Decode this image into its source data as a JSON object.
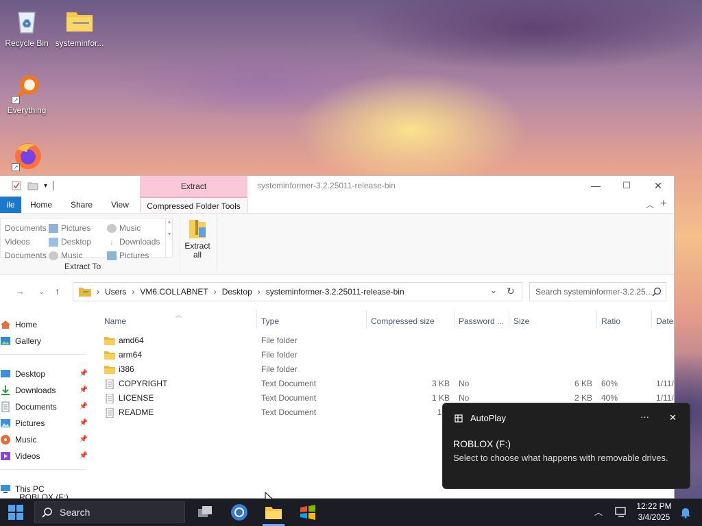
{
  "desktop": {
    "icons": [
      {
        "label": "Recycle Bin"
      },
      {
        "label": "systeminfor..."
      },
      {
        "label": "Everything"
      },
      {
        "label": ""
      }
    ]
  },
  "window": {
    "title": "systeminformer-3.2.25011-release-bin",
    "contextual_tab": "Extract",
    "tabs": {
      "file": "ile",
      "home": "Home",
      "share": "Share",
      "view": "View",
      "compressed": "Compressed Folder Tools"
    },
    "controls": {
      "minimize": "—",
      "maximize": "☐",
      "close": "✕"
    },
    "ribbon": {
      "extract_to_items": [
        [
          "Documents",
          "Videos",
          "Documents"
        ],
        [
          "Pictures",
          "Desktop",
          "Music"
        ],
        [
          "Music",
          "Downloads",
          "Pictures"
        ]
      ],
      "extract_to_label": "Extract To",
      "extract_all_label": "Extract all"
    },
    "address": {
      "crumbs": [
        "Users",
        "VM6.COLLABNET",
        "Desktop",
        "systeminformer-3.2.25011-release-bin"
      ],
      "search_placeholder": "Search systeminformer-3.2.25..."
    },
    "nav": {
      "home": "Home",
      "gallery": "Gallery",
      "desktop": "Desktop",
      "downloads": "Downloads",
      "documents": "Documents",
      "pictures": "Pictures",
      "music": "Music",
      "videos": "Videos",
      "this_pc": "This PC",
      "drive": "ROBLOX (F:)"
    },
    "columns": {
      "name": "Name",
      "type": "Type",
      "compressed_size": "Compressed size",
      "password": "Password ...",
      "size": "Size",
      "ratio": "Ratio",
      "date": "Date"
    },
    "files": [
      {
        "name": "amd64",
        "type": "File folder",
        "compressed": "",
        "password": "",
        "size": "",
        "ratio": "",
        "date": ""
      },
      {
        "name": "arm64",
        "type": "File folder",
        "compressed": "",
        "password": "",
        "size": "",
        "ratio": "",
        "date": ""
      },
      {
        "name": "i386",
        "type": "File folder",
        "compressed": "",
        "password": "",
        "size": "",
        "ratio": "",
        "date": ""
      },
      {
        "name": "COPYRIGHT",
        "type": "Text Document",
        "compressed": "3 KB",
        "password": "No",
        "size": "6 KB",
        "ratio": "60%",
        "date": "1/11/"
      },
      {
        "name": "LICENSE",
        "type": "Text Document",
        "compressed": "1 KB",
        "password": "No",
        "size": "2 KB",
        "ratio": "40%",
        "date": "1/11/"
      },
      {
        "name": "README",
        "type": "Text Document",
        "compressed": "1 K",
        "password": "",
        "size": "",
        "ratio": "",
        "date": ""
      }
    ]
  },
  "toast": {
    "app": "AutoPlay",
    "more": "···",
    "close": "✕",
    "title": "ROBLOX (F:)",
    "body": "Select to choose what happens with removable drives."
  },
  "taskbar": {
    "search": "Search",
    "time": "12:22 PM",
    "date": "3/4/2025"
  },
  "colors": {
    "accent": "#1979ca",
    "contextual": "#fac8d8",
    "folder": "#f0c040"
  }
}
